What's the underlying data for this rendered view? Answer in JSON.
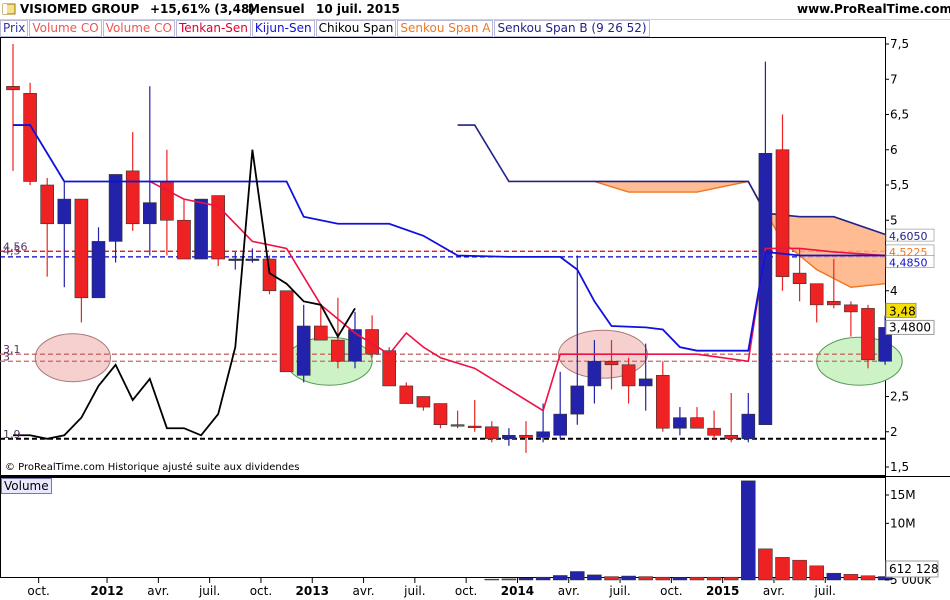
{
  "header": {
    "symbol": "VISIOMED GROUP",
    "change": "+15,61% (3,48)",
    "period": "Mensuel",
    "date": "10 juil. 2015",
    "site": "www.ProRealTime.com",
    "flag_icon": "flag-icon"
  },
  "legend": [
    {
      "label": "Prix",
      "color": "#3333aa"
    },
    {
      "label": "Volume CO",
      "color": "#ee5555"
    },
    {
      "label": "Volume CO",
      "color": "#ee5555"
    },
    {
      "label": "Tenkan-Sen",
      "color": "#dd0033"
    },
    {
      "label": "Kijun-Sen",
      "color": "#1111cc"
    },
    {
      "label": "Chikou Span",
      "color": "#000000"
    },
    {
      "label": "Senkou Span A",
      "color": "#ee7722"
    },
    {
      "label": "Senkou Span B (9 26 52)",
      "color": "#222288"
    }
  ],
  "colors": {
    "up": "#2222aa",
    "down": "#ee2222",
    "grid": "#999999",
    "tenkan": "#ee1144",
    "kijun": "#1111dd",
    "chikou": "#000000",
    "spanA": "#ee7722",
    "spanB": "#222288",
    "cloud": "#ffb080"
  },
  "footnote": "© ProRealTime.com  Historique ajusté suite aux dividendes",
  "volume_label": "Volume",
  "chart_data": {
    "type": "candlestick",
    "x_labels": [
      "oct.",
      "2012",
      "avr.",
      "juil.",
      "oct.",
      "2013",
      "avr.",
      "juil.",
      "oct.",
      "2014",
      "avr.",
      "juil.",
      "oct.",
      "2015",
      "avr.",
      "juil."
    ],
    "y_ticks": [
      1.5,
      2,
      2.5,
      3,
      3.5,
      4,
      4.5,
      5,
      5.5,
      6,
      6.5,
      7,
      7.5
    ],
    "y_tick_labels": [
      "1,5",
      "2",
      "2,5",
      "3",
      "3,5",
      "4",
      "4,5",
      "5",
      "5,5",
      "6",
      "6,5",
      "7",
      "7,5"
    ],
    "ylim": [
      1.3,
      7.7
    ],
    "last_price_label": "3,48",
    "kijun_label": "3,4800",
    "right_labels": [
      {
        "value": 4.605,
        "text": "4,6050"
      },
      {
        "value": 4.5225,
        "text": "4,5225"
      },
      {
        "value": 4.485,
        "text": "4,4850"
      }
    ],
    "left_labels": [
      {
        "value": 4.56,
        "text": "4,56"
      },
      {
        "value": 4.5,
        "text": "4,5"
      },
      {
        "value": 3.1,
        "text": "3,1"
      },
      {
        "value": 3.0,
        "text": "3"
      },
      {
        "value": 1.9,
        "text": "1,9"
      }
    ],
    "horizontal_lines": [
      {
        "value": 4.56,
        "color": "#dd0000",
        "dash": true
      },
      {
        "value": 4.48,
        "color": "#0000cc",
        "dash": true
      },
      {
        "value": 3.1,
        "color": "#cc6666",
        "dash": true
      },
      {
        "value": 3.0,
        "color": "#cc6666",
        "dash": true
      },
      {
        "value": 1.9,
        "color": "#000000",
        "dash": true
      }
    ],
    "candles": [
      {
        "o": 6.9,
        "h": 7.5,
        "l": 5.7,
        "c": 6.85
      },
      {
        "o": 6.8,
        "h": 6.95,
        "l": 5.5,
        "c": 5.55
      },
      {
        "o": 5.5,
        "h": 5.6,
        "l": 4.2,
        "c": 4.95
      },
      {
        "o": 4.95,
        "h": 5.55,
        "l": 4.05,
        "c": 5.3
      },
      {
        "o": 5.3,
        "h": 5.3,
        "l": 3.55,
        "c": 3.9
      },
      {
        "o": 3.9,
        "h": 4.9,
        "l": 3.9,
        "c": 4.7
      },
      {
        "o": 4.7,
        "h": 5.3,
        "l": 4.4,
        "c": 5.65
      },
      {
        "o": 5.7,
        "h": 6.25,
        "l": 4.85,
        "c": 4.95
      },
      {
        "o": 4.95,
        "h": 6.9,
        "l": 4.5,
        "c": 5.25
      },
      {
        "o": 5.55,
        "h": 6.0,
        "l": 4.5,
        "c": 5.0
      },
      {
        "o": 5.0,
        "h": 5.3,
        "l": 4.45,
        "c": 4.45
      },
      {
        "o": 4.45,
        "h": 5.3,
        "l": 4.45,
        "c": 5.3
      },
      {
        "o": 5.35,
        "h": 5.35,
        "l": 4.35,
        "c": 4.45
      },
      {
        "o": 4.45,
        "h": 4.55,
        "l": 4.3,
        "c": 4.45
      },
      {
        "o": 4.45,
        "h": 4.6,
        "l": 4.4,
        "c": 4.45
      },
      {
        "o": 4.45,
        "h": 4.5,
        "l": 3.95,
        "c": 4.0
      },
      {
        "o": 4.0,
        "h": 4.0,
        "l": 2.85,
        "c": 2.85
      },
      {
        "o": 2.8,
        "h": 3.8,
        "l": 2.7,
        "c": 3.5
      },
      {
        "o": 3.5,
        "h": 3.8,
        "l": 3.3,
        "c": 3.3
      },
      {
        "o": 3.3,
        "h": 3.9,
        "l": 2.9,
        "c": 3.0
      },
      {
        "o": 3.0,
        "h": 3.7,
        "l": 2.9,
        "c": 3.45
      },
      {
        "o": 3.45,
        "h": 3.65,
        "l": 3.05,
        "c": 3.1
      },
      {
        "o": 3.15,
        "h": 3.2,
        "l": 2.85,
        "c": 2.65
      },
      {
        "o": 2.65,
        "h": 2.7,
        "l": 2.4,
        "c": 2.4
      },
      {
        "o": 2.5,
        "h": 2.5,
        "l": 2.3,
        "c": 2.35
      },
      {
        "o": 2.4,
        "h": 2.4,
        "l": 2.05,
        "c": 2.1
      },
      {
        "o": 2.1,
        "h": 2.3,
        "l": 2.05,
        "c": 2.08
      },
      {
        "o": 2.08,
        "h": 2.45,
        "l": 2.0,
        "c": 2.07
      },
      {
        "o": 2.07,
        "h": 2.15,
        "l": 1.85,
        "c": 1.9
      },
      {
        "o": 1.9,
        "h": 2.05,
        "l": 1.8,
        "c": 1.95
      },
      {
        "o": 1.95,
        "h": 2.15,
        "l": 1.7,
        "c": 1.92
      },
      {
        "o": 1.92,
        "h": 2.4,
        "l": 1.85,
        "c": 2.0
      },
      {
        "o": 1.95,
        "h": 2.85,
        "l": 1.9,
        "c": 2.25
      },
      {
        "o": 2.25,
        "h": 4.5,
        "l": 2.1,
        "c": 2.65
      },
      {
        "o": 2.65,
        "h": 3.3,
        "l": 2.4,
        "c": 3.0
      },
      {
        "o": 3.0,
        "h": 3.3,
        "l": 2.6,
        "c": 2.95
      },
      {
        "o": 2.95,
        "h": 3.05,
        "l": 2.4,
        "c": 2.65
      },
      {
        "o": 2.65,
        "h": 3.25,
        "l": 2.3,
        "c": 2.75
      },
      {
        "o": 2.8,
        "h": 3.0,
        "l": 2.0,
        "c": 2.05
      },
      {
        "o": 2.05,
        "h": 2.35,
        "l": 1.95,
        "c": 2.2
      },
      {
        "o": 2.2,
        "h": 2.35,
        "l": 2.05,
        "c": 2.05
      },
      {
        "o": 2.05,
        "h": 2.3,
        "l": 1.9,
        "c": 1.95
      },
      {
        "o": 1.95,
        "h": 2.55,
        "l": 1.85,
        "c": 1.9
      },
      {
        "o": 1.9,
        "h": 2.55,
        "l": 1.85,
        "c": 2.25
      },
      {
        "o": 2.1,
        "h": 7.25,
        "l": 2.1,
        "c": 5.95
      },
      {
        "o": 6.0,
        "h": 6.5,
        "l": 4.0,
        "c": 4.2
      },
      {
        "o": 4.25,
        "h": 4.6,
        "l": 3.85,
        "c": 4.1
      },
      {
        "o": 4.1,
        "h": 4.1,
        "l": 3.55,
        "c": 3.8
      },
      {
        "o": 3.85,
        "h": 4.45,
        "l": 3.75,
        "c": 3.8
      },
      {
        "o": 3.8,
        "h": 3.85,
        "l": 3.35,
        "c": 3.7
      },
      {
        "o": 3.75,
        "h": 3.8,
        "l": 2.9,
        "c": 3.02
      },
      {
        "o": 3.0,
        "h": 3.65,
        "l": 2.95,
        "c": 3.48
      }
    ],
    "tenkan": [
      [
        8,
        5.55
      ],
      [
        10,
        5.3
      ],
      [
        12,
        5.2
      ],
      [
        14,
        4.7
      ],
      [
        16,
        4.6
      ],
      [
        17,
        4.2
      ],
      [
        18,
        3.8
      ],
      [
        19,
        3.6
      ],
      [
        20,
        3.4
      ],
      [
        22,
        3.1
      ],
      [
        23,
        3.4
      ],
      [
        24,
        3.2
      ],
      [
        25,
        3.05
      ],
      [
        27,
        2.9
      ],
      [
        29,
        2.6
      ],
      [
        31,
        2.3
      ],
      [
        32,
        3.1
      ],
      [
        38,
        3.1
      ],
      [
        40,
        3.1
      ],
      [
        43,
        3.0
      ],
      [
        44,
        4.6
      ],
      [
        46,
        4.6
      ],
      [
        48,
        4.55
      ],
      [
        51,
        4.5
      ]
    ],
    "kijun": [
      [
        0,
        6.35
      ],
      [
        1,
        6.35
      ],
      [
        2,
        5.95
      ],
      [
        3,
        5.55
      ],
      [
        10,
        5.55
      ],
      [
        16,
        5.55
      ],
      [
        17,
        5.05
      ],
      [
        19,
        4.95
      ],
      [
        22,
        4.95
      ],
      [
        24,
        4.78
      ],
      [
        26,
        4.5
      ],
      [
        29,
        4.48
      ],
      [
        32,
        4.48
      ],
      [
        33,
        4.3
      ],
      [
        34,
        3.85
      ],
      [
        35,
        3.5
      ],
      [
        37,
        3.48
      ],
      [
        38,
        3.45
      ],
      [
        39,
        3.2
      ],
      [
        40,
        3.15
      ],
      [
        43,
        3.15
      ],
      [
        44,
        4.55
      ],
      [
        46,
        4.5
      ],
      [
        50,
        4.5
      ],
      [
        51,
        4.5
      ]
    ],
    "chikou": [
      [
        0,
        1.95
      ],
      [
        1,
        1.95
      ],
      [
        2,
        1.9
      ],
      [
        3,
        1.95
      ],
      [
        4,
        2.2
      ],
      [
        5,
        2.65
      ],
      [
        6,
        2.95
      ],
      [
        7,
        2.45
      ],
      [
        8,
        2.75
      ],
      [
        9,
        2.05
      ],
      [
        10,
        2.05
      ],
      [
        11,
        1.95
      ],
      [
        12,
        2.25
      ],
      [
        13,
        3.2
      ],
      [
        14,
        6.0
      ],
      [
        15,
        4.25
      ],
      [
        16,
        4.1
      ],
      [
        17,
        3.85
      ],
      [
        18,
        3.8
      ],
      [
        19,
        3.35
      ],
      [
        20,
        3.75
      ]
    ],
    "spanB": [
      [
        26,
        6.35
      ],
      [
        27,
        6.35
      ],
      [
        28,
        5.95
      ],
      [
        29,
        5.55
      ],
      [
        42,
        5.55
      ],
      [
        43,
        5.55
      ],
      [
        44,
        5.1
      ],
      [
        46,
        5.05
      ],
      [
        48,
        5.05
      ],
      [
        51,
        4.8
      ]
    ],
    "spanA": [
      [
        34,
        5.55
      ],
      [
        36,
        5.4
      ],
      [
        38,
        5.4
      ],
      [
        40,
        5.4
      ],
      [
        43,
        5.55
      ],
      [
        45,
        4.7
      ],
      [
        47,
        4.3
      ],
      [
        49,
        4.05
      ],
      [
        51,
        4.1
      ]
    ],
    "ellipses": [
      {
        "i": 3.5,
        "v": 3.05,
        "rx": 2.2,
        "ry": 0.17,
        "fill": "#f6cfcf",
        "stroke": "#aa7777"
      },
      {
        "i": 18.5,
        "v": 3.0,
        "rx": 2.5,
        "ry": 0.17,
        "fill": "#ccf2c6",
        "stroke": "#559955"
      },
      {
        "i": 34.5,
        "v": 3.1,
        "rx": 2.6,
        "ry": 0.17,
        "fill": "#f6cfcf",
        "stroke": "#aa7777"
      },
      {
        "i": 49.5,
        "v": 3.0,
        "rx": 2.5,
        "ry": 0.17,
        "fill": "#ccf2c6",
        "stroke": "#559955"
      }
    ],
    "volume": {
      "ticks": [
        5000,
        10000000,
        15000000
      ],
      "tick_labels": [
        "5 000k",
        "10M",
        "15M"
      ],
      "max": 18000000,
      "last_label": "612 128",
      "values": [
        {
          "i": 28,
          "v": 150000,
          "up": false
        },
        {
          "i": 29,
          "v": 200000,
          "up": false
        },
        {
          "i": 30,
          "v": 350000,
          "up": true
        },
        {
          "i": 31,
          "v": 500000,
          "up": true
        },
        {
          "i": 32,
          "v": 800000,
          "up": true
        },
        {
          "i": 33,
          "v": 1500000,
          "up": true
        },
        {
          "i": 34,
          "v": 900000,
          "up": true
        },
        {
          "i": 35,
          "v": 600000,
          "up": false
        },
        {
          "i": 36,
          "v": 700000,
          "up": true
        },
        {
          "i": 37,
          "v": 600000,
          "up": false
        },
        {
          "i": 38,
          "v": 500000,
          "up": false
        },
        {
          "i": 39,
          "v": 450000,
          "up": true
        },
        {
          "i": 40,
          "v": 500000,
          "up": false
        },
        {
          "i": 41,
          "v": 500000,
          "up": false
        },
        {
          "i": 42,
          "v": 500000,
          "up": false
        },
        {
          "i": 43,
          "v": 17500000,
          "up": true
        },
        {
          "i": 44,
          "v": 5500000,
          "up": false
        },
        {
          "i": 45,
          "v": 4000000,
          "up": false
        },
        {
          "i": 46,
          "v": 3500000,
          "up": false
        },
        {
          "i": 47,
          "v": 2500000,
          "up": false
        },
        {
          "i": 48,
          "v": 1200000,
          "up": true
        },
        {
          "i": 49,
          "v": 1000000,
          "up": false
        },
        {
          "i": 50,
          "v": 750000,
          "up": false
        },
        {
          "i": 51,
          "v": 612128,
          "up": true
        }
      ]
    }
  }
}
